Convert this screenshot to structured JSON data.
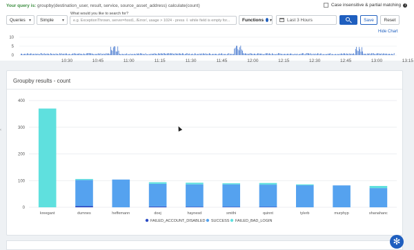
{
  "query": {
    "label": "Your query is:",
    "text": "groupby(destination_user, result, service, source_asset_address) calculate(count)"
  },
  "case_option": {
    "label": "Case insensitive & partial matching",
    "checked": false
  },
  "controls": {
    "queries_label": "Queries",
    "mode_label": "Simple",
    "search_caption": "What would you like to search for?",
    "search_placeholder": "e.g. ExceptionThrown, server=host1, /Error/, usage > 1024 - press ⇩ while field is empty for...",
    "functions_label": "Functions",
    "time_range": "Last 3 Hours",
    "save_label": "Save",
    "reset_label": "Reset",
    "hide_chart_label": "Hide Chart"
  },
  "timeline": {
    "y_ticks": [
      "0",
      "5",
      "10"
    ],
    "x_ticks": [
      "10:30",
      "10:45",
      "11:00",
      "11:15",
      "11:30",
      "11:45",
      "12:00",
      "12:15",
      "12:30",
      "12:45",
      "13:00",
      "13:15"
    ]
  },
  "panel": {
    "title": "Groupby results - count"
  },
  "chart_data": {
    "type": "bar",
    "stacked": true,
    "categories": [
      "kreegant",
      "dumnes",
      "heffemann",
      "doej",
      "haynesd",
      "smithi",
      "quinnt",
      "tylerb",
      "murphyp",
      "shanahanc"
    ],
    "series": [
      {
        "name": "FAILED_ACCOUNT_DISABLED",
        "color": "#2b4bc4",
        "values": [
          0,
          5,
          0,
          3,
          2,
          2,
          2,
          0,
          0,
          0
        ]
      },
      {
        "name": "SUCCESS",
        "color": "#55a2ef",
        "values": [
          0,
          97,
          104,
          85,
          84,
          84,
          83,
          83,
          82,
          72
        ]
      },
      {
        "name": "FAILED_BAD_LOGIN",
        "color": "#5fe0de",
        "values": [
          370,
          4,
          0,
          6,
          6,
          4,
          6,
          3,
          0,
          8
        ]
      }
    ],
    "y_ticks": [
      0,
      100,
      200,
      300,
      400
    ],
    "ylim": [
      0,
      400
    ],
    "xlabel": "",
    "ylabel": "",
    "grid": true,
    "legend_position": "bottom"
  }
}
